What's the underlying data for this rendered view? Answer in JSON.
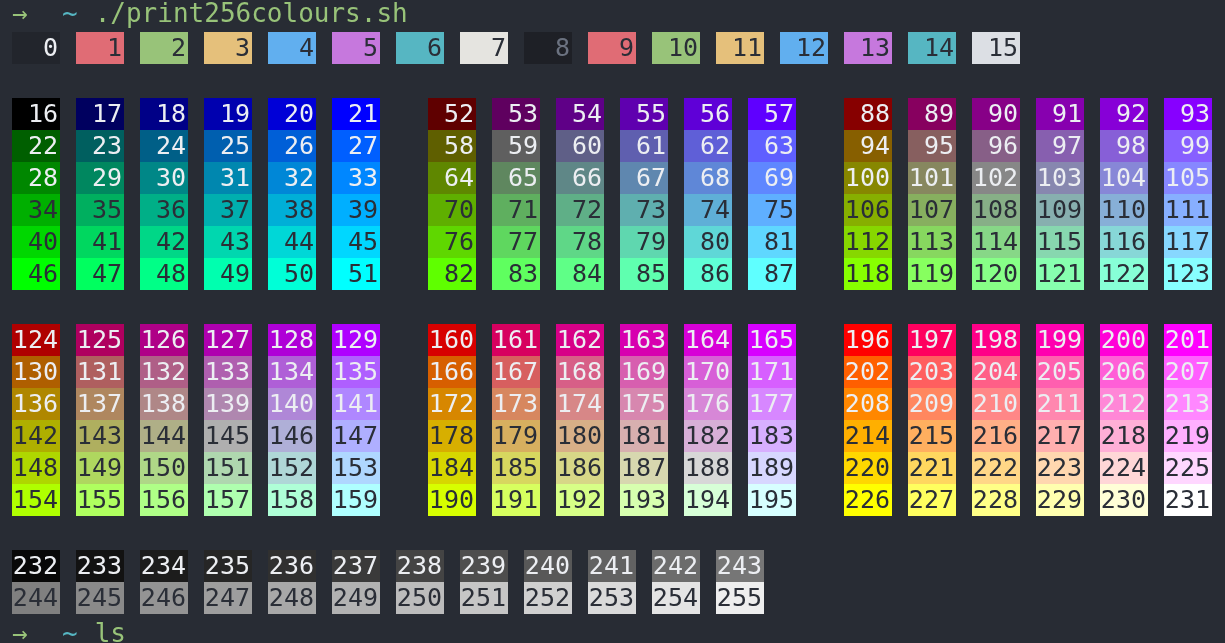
{
  "prompt": {
    "arrow": "→",
    "path": "~",
    "command": "./print256colours.sh"
  },
  "system_colors": [
    {
      "label": "0",
      "color": "#22252c",
      "dark_text": false
    },
    {
      "label": "1",
      "color": "#e06c75",
      "dark_text": true
    },
    {
      "label": "2",
      "color": "#98c379",
      "dark_text": true
    },
    {
      "label": "3",
      "color": "#e5c07b",
      "dark_text": true
    },
    {
      "label": "4",
      "color": "#61afef",
      "dark_text": true
    },
    {
      "label": "5",
      "color": "#c678dd",
      "dark_text": true
    },
    {
      "label": "6",
      "color": "#56b6c2",
      "dark_text": true
    },
    {
      "label": "7",
      "color": "#e5e4e0",
      "dark_text": true
    },
    {
      "label": "8",
      "color": "#1e2026",
      "dark_text": true
    },
    {
      "label": "9",
      "color": "#e06c75",
      "dark_text": true
    },
    {
      "label": "10",
      "color": "#98c379",
      "dark_text": true
    },
    {
      "label": "11",
      "color": "#e5c07b",
      "dark_text": true
    },
    {
      "label": "12",
      "color": "#61afef",
      "dark_text": true
    },
    {
      "label": "13",
      "color": "#c678dd",
      "dark_text": true
    },
    {
      "label": "14",
      "color": "#56b6c2",
      "dark_text": true
    },
    {
      "label": "15",
      "color": "#dcdfe4",
      "dark_text": true
    }
  ],
  "cube_groups": [
    {
      "blocks": [
        {
          "rows": [
            [
              {
                "label": "16",
                "color": "#000000",
                "dark_text": false
              },
              {
                "label": "17",
                "color": "#00005f",
                "dark_text": false
              },
              {
                "label": "18",
                "color": "#000087",
                "dark_text": false
              },
              {
                "label": "19",
                "color": "#0000af",
                "dark_text": false
              },
              {
                "label": "20",
                "color": "#0000d7",
                "dark_text": false
              },
              {
                "label": "21",
                "color": "#0000ff",
                "dark_text": false
              }
            ],
            [
              {
                "label": "22",
                "color": "#005f00",
                "dark_text": false
              },
              {
                "label": "23",
                "color": "#005f5f",
                "dark_text": false
              },
              {
                "label": "24",
                "color": "#005f87",
                "dark_text": false
              },
              {
                "label": "25",
                "color": "#005faf",
                "dark_text": false
              },
              {
                "label": "26",
                "color": "#005fd7",
                "dark_text": false
              },
              {
                "label": "27",
                "color": "#005fff",
                "dark_text": false
              }
            ],
            [
              {
                "label": "28",
                "color": "#008700",
                "dark_text": false
              },
              {
                "label": "29",
                "color": "#00875f",
                "dark_text": false
              },
              {
                "label": "30",
                "color": "#008787",
                "dark_text": false
              },
              {
                "label": "31",
                "color": "#0087af",
                "dark_text": false
              },
              {
                "label": "32",
                "color": "#0087d7",
                "dark_text": false
              },
              {
                "label": "33",
                "color": "#0087ff",
                "dark_text": false
              }
            ],
            [
              {
                "label": "34",
                "color": "#00af00",
                "dark_text": true
              },
              {
                "label": "35",
                "color": "#00af5f",
                "dark_text": true
              },
              {
                "label": "36",
                "color": "#00af87",
                "dark_text": true
              },
              {
                "label": "37",
                "color": "#00afaf",
                "dark_text": true
              },
              {
                "label": "38",
                "color": "#00afd7",
                "dark_text": true
              },
              {
                "label": "39",
                "color": "#00afff",
                "dark_text": true
              }
            ],
            [
              {
                "label": "40",
                "color": "#00d700",
                "dark_text": true
              },
              {
                "label": "41",
                "color": "#00d75f",
                "dark_text": true
              },
              {
                "label": "42",
                "color": "#00d787",
                "dark_text": true
              },
              {
                "label": "43",
                "color": "#00d7af",
                "dark_text": true
              },
              {
                "label": "44",
                "color": "#00d7d7",
                "dark_text": true
              },
              {
                "label": "45",
                "color": "#00d7ff",
                "dark_text": true
              }
            ],
            [
              {
                "label": "46",
                "color": "#00ff00",
                "dark_text": true
              },
              {
                "label": "47",
                "color": "#00ff5f",
                "dark_text": true
              },
              {
                "label": "48",
                "color": "#00ff87",
                "dark_text": true
              },
              {
                "label": "49",
                "color": "#00ffaf",
                "dark_text": true
              },
              {
                "label": "50",
                "color": "#00ffd7",
                "dark_text": true
              },
              {
                "label": "51",
                "color": "#00ffff",
                "dark_text": true
              }
            ]
          ]
        },
        {
          "rows": [
            [
              {
                "label": "52",
                "color": "#5f0000",
                "dark_text": false
              },
              {
                "label": "53",
                "color": "#5f005f",
                "dark_text": false
              },
              {
                "label": "54",
                "color": "#5f0087",
                "dark_text": false
              },
              {
                "label": "55",
                "color": "#5f00af",
                "dark_text": false
              },
              {
                "label": "56",
                "color": "#5f00d7",
                "dark_text": false
              },
              {
                "label": "57",
                "color": "#5f00ff",
                "dark_text": false
              }
            ],
            [
              {
                "label": "58",
                "color": "#5f5f00",
                "dark_text": false
              },
              {
                "label": "59",
                "color": "#5f5f5f",
                "dark_text": false
              },
              {
                "label": "60",
                "color": "#5f5f87",
                "dark_text": false
              },
              {
                "label": "61",
                "color": "#5f5faf",
                "dark_text": false
              },
              {
                "label": "62",
                "color": "#5f5fd7",
                "dark_text": false
              },
              {
                "label": "63",
                "color": "#5f5fff",
                "dark_text": false
              }
            ],
            [
              {
                "label": "64",
                "color": "#5f8700",
                "dark_text": false
              },
              {
                "label": "65",
                "color": "#5f875f",
                "dark_text": false
              },
              {
                "label": "66",
                "color": "#5f8787",
                "dark_text": false
              },
              {
                "label": "67",
                "color": "#5f87af",
                "dark_text": false
              },
              {
                "label": "68",
                "color": "#5f87d7",
                "dark_text": false
              },
              {
                "label": "69",
                "color": "#5f87ff",
                "dark_text": false
              }
            ],
            [
              {
                "label": "70",
                "color": "#5faf00",
                "dark_text": true
              },
              {
                "label": "71",
                "color": "#5faf5f",
                "dark_text": true
              },
              {
                "label": "72",
                "color": "#5faf87",
                "dark_text": true
              },
              {
                "label": "73",
                "color": "#5fafaf",
                "dark_text": true
              },
              {
                "label": "74",
                "color": "#5fafd7",
                "dark_text": true
              },
              {
                "label": "75",
                "color": "#5fafff",
                "dark_text": true
              }
            ],
            [
              {
                "label": "76",
                "color": "#5fd700",
                "dark_text": true
              },
              {
                "label": "77",
                "color": "#5fd75f",
                "dark_text": true
              },
              {
                "label": "78",
                "color": "#5fd787",
                "dark_text": true
              },
              {
                "label": "79",
                "color": "#5fd7af",
                "dark_text": true
              },
              {
                "label": "80",
                "color": "#5fd7d7",
                "dark_text": true
              },
              {
                "label": "81",
                "color": "#5fd7ff",
                "dark_text": true
              }
            ],
            [
              {
                "label": "82",
                "color": "#5fff00",
                "dark_text": true
              },
              {
                "label": "83",
                "color": "#5fff5f",
                "dark_text": true
              },
              {
                "label": "84",
                "color": "#5fff87",
                "dark_text": true
              },
              {
                "label": "85",
                "color": "#5fffaf",
                "dark_text": true
              },
              {
                "label": "86",
                "color": "#5fffd7",
                "dark_text": true
              },
              {
                "label": "87",
                "color": "#5fffff",
                "dark_text": true
              }
            ]
          ]
        },
        {
          "rows": [
            [
              {
                "label": "88",
                "color": "#870000",
                "dark_text": false
              },
              {
                "label": "89",
                "color": "#87005f",
                "dark_text": false
              },
              {
                "label": "90",
                "color": "#870087",
                "dark_text": false
              },
              {
                "label": "91",
                "color": "#8700af",
                "dark_text": false
              },
              {
                "label": "92",
                "color": "#8700d7",
                "dark_text": false
              },
              {
                "label": "93",
                "color": "#8700ff",
                "dark_text": false
              }
            ],
            [
              {
                "label": "94",
                "color": "#875f00",
                "dark_text": false
              },
              {
                "label": "95",
                "color": "#875f5f",
                "dark_text": false
              },
              {
                "label": "96",
                "color": "#875f87",
                "dark_text": false
              },
              {
                "label": "97",
                "color": "#875faf",
                "dark_text": false
              },
              {
                "label": "98",
                "color": "#875fd7",
                "dark_text": false
              },
              {
                "label": "99",
                "color": "#875fff",
                "dark_text": false
              }
            ],
            [
              {
                "label": "100",
                "color": "#878700",
                "dark_text": false
              },
              {
                "label": "101",
                "color": "#87875f",
                "dark_text": false
              },
              {
                "label": "102",
                "color": "#878787",
                "dark_text": false
              },
              {
                "label": "103",
                "color": "#8787af",
                "dark_text": false
              },
              {
                "label": "104",
                "color": "#8787d7",
                "dark_text": false
              },
              {
                "label": "105",
                "color": "#8787ff",
                "dark_text": false
              }
            ],
            [
              {
                "label": "106",
                "color": "#87af00",
                "dark_text": true
              },
              {
                "label": "107",
                "color": "#87af5f",
                "dark_text": true
              },
              {
                "label": "108",
                "color": "#87af87",
                "dark_text": true
              },
              {
                "label": "109",
                "color": "#87afaf",
                "dark_text": true
              },
              {
                "label": "110",
                "color": "#87afd7",
                "dark_text": true
              },
              {
                "label": "111",
                "color": "#87afff",
                "dark_text": true
              }
            ],
            [
              {
                "label": "112",
                "color": "#87d700",
                "dark_text": true
              },
              {
                "label": "113",
                "color": "#87d75f",
                "dark_text": true
              },
              {
                "label": "114",
                "color": "#87d787",
                "dark_text": true
              },
              {
                "label": "115",
                "color": "#87d7af",
                "dark_text": true
              },
              {
                "label": "116",
                "color": "#87d7d7",
                "dark_text": true
              },
              {
                "label": "117",
                "color": "#87d7ff",
                "dark_text": true
              }
            ],
            [
              {
                "label": "118",
                "color": "#87ff00",
                "dark_text": true
              },
              {
                "label": "119",
                "color": "#87ff5f",
                "dark_text": true
              },
              {
                "label": "120",
                "color": "#87ff87",
                "dark_text": true
              },
              {
                "label": "121",
                "color": "#87ffaf",
                "dark_text": true
              },
              {
                "label": "122",
                "color": "#87ffd7",
                "dark_text": true
              },
              {
                "label": "123",
                "color": "#87ffff",
                "dark_text": true
              }
            ]
          ]
        }
      ]
    },
    {
      "blocks": [
        {
          "rows": [
            [
              {
                "label": "124",
                "color": "#af0000",
                "dark_text": false
              },
              {
                "label": "125",
                "color": "#af005f",
                "dark_text": false
              },
              {
                "label": "126",
                "color": "#af0087",
                "dark_text": false
              },
              {
                "label": "127",
                "color": "#af00af",
                "dark_text": false
              },
              {
                "label": "128",
                "color": "#af00d7",
                "dark_text": false
              },
              {
                "label": "129",
                "color": "#af00ff",
                "dark_text": false
              }
            ],
            [
              {
                "label": "130",
                "color": "#af5f00",
                "dark_text": false
              },
              {
                "label": "131",
                "color": "#af5f5f",
                "dark_text": false
              },
              {
                "label": "132",
                "color": "#af5f87",
                "dark_text": false
              },
              {
                "label": "133",
                "color": "#af5faf",
                "dark_text": false
              },
              {
                "label": "134",
                "color": "#af5fd7",
                "dark_text": false
              },
              {
                "label": "135",
                "color": "#af5fff",
                "dark_text": false
              }
            ],
            [
              {
                "label": "136",
                "color": "#af8700",
                "dark_text": false
              },
              {
                "label": "137",
                "color": "#af875f",
                "dark_text": false
              },
              {
                "label": "138",
                "color": "#af8787",
                "dark_text": false
              },
              {
                "label": "139",
                "color": "#af87af",
                "dark_text": false
              },
              {
                "label": "140",
                "color": "#af87d7",
                "dark_text": false
              },
              {
                "label": "141",
                "color": "#af87ff",
                "dark_text": false
              }
            ],
            [
              {
                "label": "142",
                "color": "#afaf00",
                "dark_text": true
              },
              {
                "label": "143",
                "color": "#afaf5f",
                "dark_text": true
              },
              {
                "label": "144",
                "color": "#afaf87",
                "dark_text": true
              },
              {
                "label": "145",
                "color": "#afafaf",
                "dark_text": true
              },
              {
                "label": "146",
                "color": "#afafd7",
                "dark_text": true
              },
              {
                "label": "147",
                "color": "#afafff",
                "dark_text": true
              }
            ],
            [
              {
                "label": "148",
                "color": "#afd700",
                "dark_text": true
              },
              {
                "label": "149",
                "color": "#afd75f",
                "dark_text": true
              },
              {
                "label": "150",
                "color": "#afd787",
                "dark_text": true
              },
              {
                "label": "151",
                "color": "#afd7af",
                "dark_text": true
              },
              {
                "label": "152",
                "color": "#afd7d7",
                "dark_text": true
              },
              {
                "label": "153",
                "color": "#afd7ff",
                "dark_text": true
              }
            ],
            [
              {
                "label": "154",
                "color": "#afff00",
                "dark_text": true
              },
              {
                "label": "155",
                "color": "#afff5f",
                "dark_text": true
              },
              {
                "label": "156",
                "color": "#afff87",
                "dark_text": true
              },
              {
                "label": "157",
                "color": "#afffaf",
                "dark_text": true
              },
              {
                "label": "158",
                "color": "#afffd7",
                "dark_text": true
              },
              {
                "label": "159",
                "color": "#afffff",
                "dark_text": true
              }
            ]
          ]
        },
        {
          "rows": [
            [
              {
                "label": "160",
                "color": "#d70000",
                "dark_text": false
              },
              {
                "label": "161",
                "color": "#d7005f",
                "dark_text": false
              },
              {
                "label": "162",
                "color": "#d70087",
                "dark_text": false
              },
              {
                "label": "163",
                "color": "#d700af",
                "dark_text": false
              },
              {
                "label": "164",
                "color": "#d700d7",
                "dark_text": false
              },
              {
                "label": "165",
                "color": "#d700ff",
                "dark_text": false
              }
            ],
            [
              {
                "label": "166",
                "color": "#d75f00",
                "dark_text": false
              },
              {
                "label": "167",
                "color": "#d75f5f",
                "dark_text": false
              },
              {
                "label": "168",
                "color": "#d75f87",
                "dark_text": false
              },
              {
                "label": "169",
                "color": "#d75faf",
                "dark_text": false
              },
              {
                "label": "170",
                "color": "#d75fd7",
                "dark_text": false
              },
              {
                "label": "171",
                "color": "#d75fff",
                "dark_text": false
              }
            ],
            [
              {
                "label": "172",
                "color": "#d78700",
                "dark_text": false
              },
              {
                "label": "173",
                "color": "#d7875f",
                "dark_text": false
              },
              {
                "label": "174",
                "color": "#d78787",
                "dark_text": false
              },
              {
                "label": "175",
                "color": "#d787af",
                "dark_text": false
              },
              {
                "label": "176",
                "color": "#d787d7",
                "dark_text": false
              },
              {
                "label": "177",
                "color": "#d787ff",
                "dark_text": false
              }
            ],
            [
              {
                "label": "178",
                "color": "#d7af00",
                "dark_text": true
              },
              {
                "label": "179",
                "color": "#d7af5f",
                "dark_text": true
              },
              {
                "label": "180",
                "color": "#d7af87",
                "dark_text": true
              },
              {
                "label": "181",
                "color": "#d7afaf",
                "dark_text": true
              },
              {
                "label": "182",
                "color": "#d7afd7",
                "dark_text": true
              },
              {
                "label": "183",
                "color": "#d7afff",
                "dark_text": true
              }
            ],
            [
              {
                "label": "184",
                "color": "#d7d700",
                "dark_text": true
              },
              {
                "label": "185",
                "color": "#d7d75f",
                "dark_text": true
              },
              {
                "label": "186",
                "color": "#d7d787",
                "dark_text": true
              },
              {
                "label": "187",
                "color": "#d7d7af",
                "dark_text": true
              },
              {
                "label": "188",
                "color": "#d7d7d7",
                "dark_text": true
              },
              {
                "label": "189",
                "color": "#d7d7ff",
                "dark_text": true
              }
            ],
            [
              {
                "label": "190",
                "color": "#d7ff00",
                "dark_text": true
              },
              {
                "label": "191",
                "color": "#d7ff5f",
                "dark_text": true
              },
              {
                "label": "192",
                "color": "#d7ff87",
                "dark_text": true
              },
              {
                "label": "193",
                "color": "#d7ffaf",
                "dark_text": true
              },
              {
                "label": "194",
                "color": "#d7ffd7",
                "dark_text": true
              },
              {
                "label": "195",
                "color": "#d7ffff",
                "dark_text": true
              }
            ]
          ]
        },
        {
          "rows": [
            [
              {
                "label": "196",
                "color": "#ff0000",
                "dark_text": false
              },
              {
                "label": "197",
                "color": "#ff005f",
                "dark_text": false
              },
              {
                "label": "198",
                "color": "#ff0087",
                "dark_text": false
              },
              {
                "label": "199",
                "color": "#ff00af",
                "dark_text": false
              },
              {
                "label": "200",
                "color": "#ff00d7",
                "dark_text": false
              },
              {
                "label": "201",
                "color": "#ff00ff",
                "dark_text": false
              }
            ],
            [
              {
                "label": "202",
                "color": "#ff5f00",
                "dark_text": false
              },
              {
                "label": "203",
                "color": "#ff5f5f",
                "dark_text": false
              },
              {
                "label": "204",
                "color": "#ff5f87",
                "dark_text": false
              },
              {
                "label": "205",
                "color": "#ff5faf",
                "dark_text": false
              },
              {
                "label": "206",
                "color": "#ff5fd7",
                "dark_text": false
              },
              {
                "label": "207",
                "color": "#ff5fff",
                "dark_text": false
              }
            ],
            [
              {
                "label": "208",
                "color": "#ff8700",
                "dark_text": false
              },
              {
                "label": "209",
                "color": "#ff875f",
                "dark_text": false
              },
              {
                "label": "210",
                "color": "#ff8787",
                "dark_text": false
              },
              {
                "label": "211",
                "color": "#ff87af",
                "dark_text": false
              },
              {
                "label": "212",
                "color": "#ff87d7",
                "dark_text": false
              },
              {
                "label": "213",
                "color": "#ff87ff",
                "dark_text": false
              }
            ],
            [
              {
                "label": "214",
                "color": "#ffaf00",
                "dark_text": true
              },
              {
                "label": "215",
                "color": "#ffaf5f",
                "dark_text": true
              },
              {
                "label": "216",
                "color": "#ffaf87",
                "dark_text": true
              },
              {
                "label": "217",
                "color": "#ffafaf",
                "dark_text": true
              },
              {
                "label": "218",
                "color": "#ffafd7",
                "dark_text": true
              },
              {
                "label": "219",
                "color": "#ffafff",
                "dark_text": true
              }
            ],
            [
              {
                "label": "220",
                "color": "#ffd700",
                "dark_text": true
              },
              {
                "label": "221",
                "color": "#ffd75f",
                "dark_text": true
              },
              {
                "label": "222",
                "color": "#ffd787",
                "dark_text": true
              },
              {
                "label": "223",
                "color": "#ffd7af",
                "dark_text": true
              },
              {
                "label": "224",
                "color": "#ffd7d7",
                "dark_text": true
              },
              {
                "label": "225",
                "color": "#ffd7ff",
                "dark_text": true
              }
            ],
            [
              {
                "label": "226",
                "color": "#ffff00",
                "dark_text": true
              },
              {
                "label": "227",
                "color": "#ffff5f",
                "dark_text": true
              },
              {
                "label": "228",
                "color": "#ffff87",
                "dark_text": true
              },
              {
                "label": "229",
                "color": "#ffffaf",
                "dark_text": true
              },
              {
                "label": "230",
                "color": "#ffffd7",
                "dark_text": true
              },
              {
                "label": "231",
                "color": "#ffffff",
                "dark_text": true
              }
            ]
          ]
        }
      ]
    }
  ],
  "grayscale_rows": [
    [
      {
        "label": "232",
        "color": "#080808",
        "dark_text": false
      },
      {
        "label": "233",
        "color": "#121212",
        "dark_text": false
      },
      {
        "label": "234",
        "color": "#1c1c1c",
        "dark_text": false
      },
      {
        "label": "235",
        "color": "#262626",
        "dark_text": false
      },
      {
        "label": "236",
        "color": "#303030",
        "dark_text": false
      },
      {
        "label": "237",
        "color": "#3a3a3a",
        "dark_text": false
      },
      {
        "label": "238",
        "color": "#444444",
        "dark_text": false
      },
      {
        "label": "239",
        "color": "#4e4e4e",
        "dark_text": false
      },
      {
        "label": "240",
        "color": "#585858",
        "dark_text": false
      },
      {
        "label": "241",
        "color": "#626262",
        "dark_text": false
      },
      {
        "label": "242",
        "color": "#6c6c6c",
        "dark_text": false
      },
      {
        "label": "243",
        "color": "#767676",
        "dark_text": false
      }
    ],
    [
      {
        "label": "244",
        "color": "#808080",
        "dark_text": true
      },
      {
        "label": "245",
        "color": "#8a8a8a",
        "dark_text": true
      },
      {
        "label": "246",
        "color": "#949494",
        "dark_text": true
      },
      {
        "label": "247",
        "color": "#9e9e9e",
        "dark_text": true
      },
      {
        "label": "248",
        "color": "#a8a8a8",
        "dark_text": true
      },
      {
        "label": "249",
        "color": "#b2b2b2",
        "dark_text": true
      },
      {
        "label": "250",
        "color": "#bcbcbc",
        "dark_text": true
      },
      {
        "label": "251",
        "color": "#c6c6c6",
        "dark_text": true
      },
      {
        "label": "252",
        "color": "#d0d0d0",
        "dark_text": true
      },
      {
        "label": "253",
        "color": "#dadada",
        "dark_text": true
      },
      {
        "label": "254",
        "color": "#e4e4e4",
        "dark_text": true
      },
      {
        "label": "255",
        "color": "#eeeeee",
        "dark_text": true
      }
    ]
  ],
  "next_prompt": {
    "arrow": "→",
    "path": "~",
    "command": "ls"
  }
}
